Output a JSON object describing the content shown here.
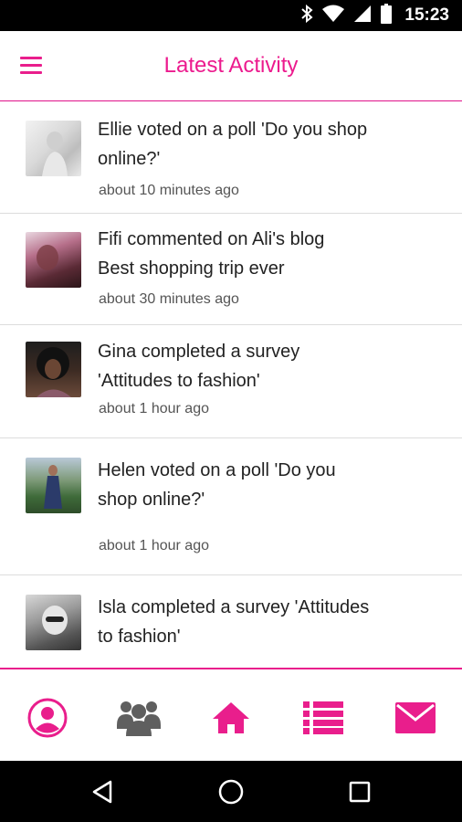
{
  "status_bar": {
    "time": "15:23"
  },
  "header": {
    "title": "Latest Activity"
  },
  "feed": [
    {
      "line1": "Ellie voted on a poll 'Do you shop",
      "line2": "online?'",
      "time": "about 10 minutes ago"
    },
    {
      "line1": "Fifi commented on Ali's blog",
      "line2": "Best shopping trip ever",
      "time": "about 30 minutes ago"
    },
    {
      "line1": "Gina completed a survey",
      "line2": "'Attitudes to fashion'",
      "time": "about 1 hour ago"
    },
    {
      "line1": "Helen voted on a poll 'Do you",
      "line2": "shop online?'",
      "time": "about 1 hour ago"
    },
    {
      "line1": "Isla completed a survey 'Attitudes",
      "line2": "to fashion'",
      "time": ""
    }
  ],
  "nav": [
    "profile-icon",
    "group-icon",
    "home-icon",
    "list-icon",
    "mail-icon"
  ],
  "colors": {
    "accent": "#e91e8c",
    "nav_gray": "#5f5f5f"
  }
}
